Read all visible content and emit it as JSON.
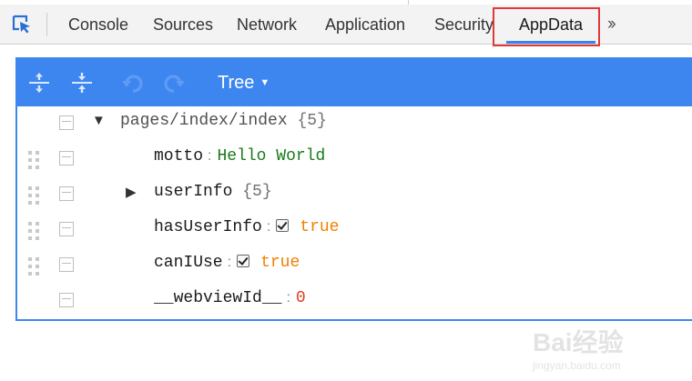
{
  "devtools": {
    "tabs": [
      {
        "label": "Console"
      },
      {
        "label": "Sources"
      },
      {
        "label": "Network"
      },
      {
        "label": "Application"
      },
      {
        "label": "Security"
      },
      {
        "label": "AppData",
        "active": true
      }
    ],
    "more_icon": "double-chevron-right-icon",
    "inspect_icon": "inspect-element-icon",
    "accent_color": "#3d86f0",
    "highlight_color": "#e03a3a"
  },
  "appdata": {
    "toolbar": {
      "icons": [
        "expand-all-icon",
        "collapse-all-icon",
        "undo-icon",
        "redo-icon"
      ],
      "mode_label": "Tree"
    },
    "tree": {
      "root": {
        "key": "pages/index/index",
        "count": "{5}",
        "expanded": true
      },
      "items": [
        {
          "key": "motto",
          "value": "Hello World",
          "type": "string"
        },
        {
          "key": "userInfo",
          "count": "{5}",
          "type": "object",
          "expanded": false
        },
        {
          "key": "hasUserInfo",
          "value": "true",
          "type": "boolean",
          "checked": true
        },
        {
          "key": "canIUse",
          "value": "true",
          "type": "boolean",
          "checked": true
        },
        {
          "key": "__webviewId__",
          "value": "0",
          "type": "number"
        }
      ]
    }
  },
  "watermark": {
    "text": "Bai经验",
    "url": "jingyan.baidu.com"
  }
}
